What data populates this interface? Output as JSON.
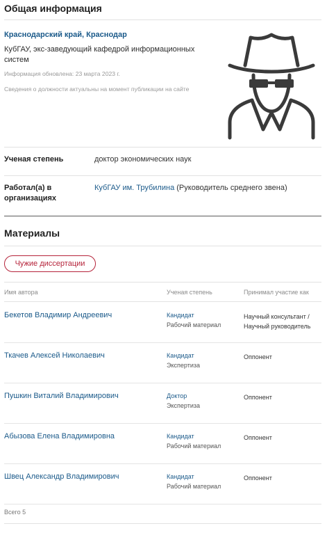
{
  "general": {
    "title": "Общая информация",
    "location": "Краснодарский край, Краснодар",
    "position": "КубГАУ, экс-заведующий кафедрой информационных систем",
    "updated": "Информация обновлена: 23 марта 2023 г.",
    "note": "Сведения о должности актуальны на момент публикации на сайте",
    "avatar_icon": "incognito-person-icon"
  },
  "degree": {
    "label": "Ученая степень",
    "value": "доктор экономических наук"
  },
  "worked": {
    "label_line1": "Работал(а) в",
    "label_line2": "организациях",
    "org_link": "КубГАУ им. Трубилина",
    "org_role": " (Руководитель среднего звена)"
  },
  "materials": {
    "title": "Материалы",
    "tab_label": "Чужие диссертации",
    "columns": [
      "Имя автора",
      "Ученая степень",
      "Принимал участие как"
    ],
    "rows": [
      {
        "author": "Бекетов Владимир Андреевич",
        "degree": "Кандидат",
        "type": "Рабочий материал",
        "participation": "Научный консультант / Научный руководитель"
      },
      {
        "author": "Ткачев Алексей Николаевич",
        "degree": "Кандидат",
        "type": "Экспертиза",
        "participation": "Оппонент"
      },
      {
        "author": "Пушкин Виталий Владимирович",
        "degree": "Доктор",
        "type": "Экспертиза",
        "participation": "Оппонент"
      },
      {
        "author": "Абызова Елена Владимировна",
        "degree": "Кандидат",
        "type": "Рабочий материал",
        "participation": "Оппонент"
      },
      {
        "author": "Швец Александр Владимирович",
        "degree": "Кандидат",
        "type": "Рабочий материал",
        "participation": "Оппонент"
      }
    ],
    "total": "Всего 5"
  },
  "colors": {
    "link": "#1b5a8a",
    "accent": "#b5233a"
  }
}
